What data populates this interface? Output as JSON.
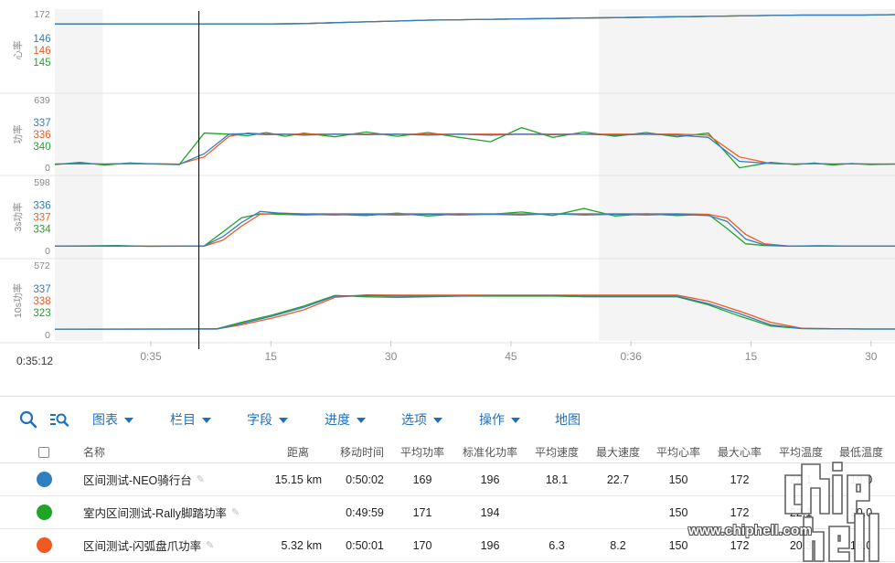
{
  "colors": {
    "series_blue": "#2f7ec1",
    "series_orange": "#f05a22",
    "series_green": "#21a32a",
    "accent": "#1f6fbf",
    "selection_fill": "#ffffff",
    "outside_fill": "#f4f4f4"
  },
  "chart_data": [
    {
      "type": "line",
      "ylabel": "心率",
      "ylim": [
        0,
        172
      ],
      "y_top_label": "172",
      "y_bottom_label": "",
      "legend_values": [
        {
          "series": "区间测试-NEO骑行台",
          "value": "146"
        },
        {
          "series": "区间测试-闪弧盘爪功率",
          "value": "146"
        },
        {
          "series": "室内区间测试-Rally脚踏功率",
          "value": "145"
        }
      ],
      "x": [
        0,
        10,
        20,
        30,
        40,
        50,
        60,
        70,
        80,
        90,
        100,
        110,
        120,
        130,
        140,
        150,
        160,
        170,
        180,
        190,
        200,
        210,
        220,
        230,
        240,
        250,
        260,
        270
      ],
      "series": [
        {
          "name": "区间测试-NEO骑行台",
          "values": [
            150,
            150,
            150,
            150,
            150,
            150,
            150,
            150,
            151,
            153,
            155,
            157,
            159,
            160,
            161,
            162,
            163,
            164,
            165,
            166,
            167,
            168,
            169,
            170,
            171,
            171,
            171,
            172
          ]
        },
        {
          "name": "区间测试-闪弧盘爪功率",
          "values": [
            150,
            150,
            150,
            150,
            150,
            150,
            150,
            150,
            151,
            153,
            155,
            157,
            159,
            160,
            161,
            162,
            163,
            164,
            165,
            166,
            167,
            168,
            169,
            170,
            171,
            171,
            171,
            172
          ]
        },
        {
          "name": "室内区间测试-Rally脚踏功率",
          "values": [
            150,
            150,
            150,
            150,
            150,
            150,
            150,
            150,
            151,
            153,
            155,
            157,
            159,
            160,
            161,
            162,
            163,
            164,
            165,
            166,
            167,
            168,
            169,
            170,
            171,
            171,
            171,
            172
          ]
        }
      ]
    },
    {
      "type": "line",
      "ylabel": "功率",
      "ylim": [
        0,
        639
      ],
      "y_top_label": "639",
      "y_bottom_label": "0",
      "legend_values": [
        {
          "series": "区间测试-NEO骑行台",
          "value": "337"
        },
        {
          "series": "区间测试-闪弧盘爪功率",
          "value": "336"
        },
        {
          "series": "室内区间测试-Rally脚踏功率",
          "value": "340"
        }
      ],
      "x": [
        0,
        8,
        16,
        24,
        32,
        40,
        48,
        56,
        62,
        68,
        74,
        80,
        90,
        100,
        110,
        120,
        130,
        140,
        150,
        160,
        170,
        180,
        190,
        200,
        210,
        220,
        230,
        238,
        244,
        250,
        256,
        262,
        270
      ],
      "series": [
        {
          "name": "区间测试-NEO骑行台",
          "values": [
            55,
            60,
            55,
            60,
            58,
            52,
            150,
            330,
            335,
            325,
            330,
            320,
            330,
            325,
            330,
            320,
            330,
            320,
            330,
            325,
            330,
            320,
            330,
            320,
            300,
            80,
            60,
            55,
            60,
            55,
            58,
            55,
            55
          ]
        },
        {
          "name": "区间测试-闪弧盘爪功率",
          "values": [
            55,
            58,
            55,
            58,
            56,
            55,
            120,
            310,
            340,
            330,
            330,
            330,
            330,
            330,
            330,
            330,
            330,
            330,
            330,
            330,
            330,
            330,
            330,
            330,
            320,
            120,
            60,
            55,
            58,
            55,
            56,
            55,
            55
          ]
        },
        {
          "name": "室内区间测试-Rally脚踏功率",
          "values": [
            50,
            70,
            45,
            65,
            55,
            50,
            340,
            330,
            315,
            345,
            310,
            340,
            305,
            350,
            310,
            345,
            300,
            260,
            390,
            300,
            350,
            310,
            345,
            305,
            340,
            20,
            70,
            50,
            65,
            45,
            60,
            50,
            55
          ]
        }
      ]
    },
    {
      "type": "line",
      "ylabel": "3s功率",
      "ylim": [
        0,
        598
      ],
      "y_top_label": "598",
      "y_bottom_label": "0",
      "legend_values": [
        {
          "series": "区间测试-NEO骑行台",
          "value": "336"
        },
        {
          "series": "区间测试-闪弧盘爪功率",
          "value": "337"
        },
        {
          "series": "室内区间测试-Rally脚踏功率",
          "value": "334"
        }
      ],
      "x": [
        0,
        10,
        20,
        30,
        40,
        48,
        54,
        60,
        66,
        72,
        80,
        90,
        100,
        110,
        120,
        130,
        140,
        150,
        160,
        170,
        180,
        190,
        200,
        210,
        216,
        222,
        228,
        236,
        246,
        256,
        270
      ],
      "series": [
        {
          "name": "区间测试-NEO骑行台",
          "values": [
            60,
            60,
            62,
            58,
            60,
            62,
            140,
            260,
            355,
            340,
            330,
            325,
            330,
            325,
            330,
            325,
            330,
            325,
            335,
            325,
            330,
            325,
            330,
            320,
            270,
            120,
            70,
            60,
            62,
            60,
            60
          ]
        },
        {
          "name": "区间测试-闪弧盘爪功率",
          "values": [
            60,
            60,
            60,
            60,
            60,
            60,
            110,
            230,
            330,
            340,
            335,
            335,
            335,
            335,
            335,
            335,
            335,
            335,
            335,
            335,
            335,
            335,
            335,
            330,
            300,
            160,
            80,
            60,
            60,
            60,
            60
          ]
        },
        {
          "name": "室内区间测试-Rally脚踏功率",
          "values": [
            60,
            62,
            65,
            58,
            60,
            62,
            180,
            300,
            335,
            330,
            325,
            330,
            320,
            340,
            315,
            335,
            330,
            350,
            320,
            380,
            315,
            335,
            320,
            330,
            210,
            80,
            65,
            60,
            63,
            60,
            60
          ]
        }
      ]
    },
    {
      "type": "line",
      "ylabel": "10s功率",
      "ylim": [
        0,
        572
      ],
      "y_top_label": "572",
      "y_bottom_label": "0",
      "legend_values": [
        {
          "series": "区间测试-NEO骑行台",
          "value": "337"
        },
        {
          "series": "区间测试-闪弧盘爪功率",
          "value": "338"
        },
        {
          "series": "室内区间测试-Rally脚踏功率",
          "value": "323"
        }
      ],
      "x": [
        0,
        20,
        40,
        52,
        60,
        70,
        80,
        90,
        100,
        110,
        120,
        130,
        140,
        150,
        160,
        170,
        180,
        190,
        200,
        210,
        220,
        230,
        240,
        250,
        260,
        270
      ],
      "series": [
        {
          "name": "区间测试-NEO骑行台",
          "values": [
            65,
            65,
            66,
            66,
            110,
            170,
            240,
            330,
            335,
            330,
            330,
            330,
            335,
            335,
            335,
            330,
            330,
            330,
            330,
            270,
            190,
            100,
            70,
            68,
            66,
            66
          ]
        },
        {
          "name": "区间测试-闪弧盘爪功率",
          "values": [
            65,
            65,
            66,
            66,
            100,
            155,
            220,
            320,
            340,
            338,
            338,
            338,
            338,
            338,
            338,
            338,
            338,
            338,
            338,
            290,
            210,
            120,
            72,
            68,
            66,
            66
          ]
        },
        {
          "name": "室内区间测试-Rally脚踏功率",
          "values": [
            65,
            66,
            66,
            68,
            120,
            180,
            250,
            335,
            325,
            320,
            325,
            330,
            330,
            330,
            330,
            325,
            325,
            325,
            325,
            260,
            170,
            90,
            70,
            68,
            66,
            66
          ]
        }
      ]
    }
  ],
  "x_axis": {
    "ticks": [
      {
        "label": "0:35",
        "t": 60
      },
      {
        "label": "15",
        "t": 75
      },
      {
        "label": "30",
        "t": 90
      },
      {
        "label": "45",
        "t": 105
      },
      {
        "label": "0:36",
        "t": 120
      },
      {
        "label": "15",
        "t": 135
      },
      {
        "label": "30",
        "t": 150
      }
    ],
    "view_range": [
      48,
      153
    ],
    "selection_range": [
      54,
      116
    ],
    "cursor_t": 66
  },
  "cursor_time": "0:35:12",
  "toolbar": {
    "search_icon": "search-icon",
    "zoom_list_icon": "zoom-list-icon",
    "menus": [
      "图表",
      "栏目",
      "字段",
      "进度",
      "选项",
      "操作"
    ],
    "map_label": "地图"
  },
  "table": {
    "headers": [
      "名称",
      "距离",
      "移动时间",
      "平均功率",
      "标准化功率",
      "平均速度",
      "最大速度",
      "平均心率",
      "最大心率",
      "平均温度",
      "最低温度"
    ],
    "rows": [
      {
        "color": "#2f7ec1",
        "name": "区间测试-NEO骑行台",
        "distance": "15.15 km",
        "moving_time": "0:50:02",
        "avg_power": "169",
        "np": "196",
        "avg_speed": "18.1",
        "max_speed": "22.7",
        "avg_hr": "150",
        "max_hr": "172",
        "avg_temp": "22.1",
        "min_temp": "19.0"
      },
      {
        "color": "#21a32a",
        "name": "室内区间测试-Rally脚踏功率",
        "distance": "",
        "moving_time": "0:49:59",
        "avg_power": "171",
        "np": "194",
        "avg_speed": "",
        "max_speed": "",
        "avg_hr": "150",
        "max_hr": "172",
        "avg_temp": "22.1",
        "min_temp": "20.0"
      },
      {
        "color": "#f05a22",
        "name": "区间测试-闪弧盘爪功率",
        "distance": "5.32 km",
        "moving_time": "0:50:01",
        "avg_power": "170",
        "np": "196",
        "avg_speed": "6.3",
        "max_speed": "8.2",
        "avg_hr": "150",
        "max_hr": "172",
        "avg_temp": "20.3",
        "min_temp": "18.0"
      }
    ]
  },
  "watermark": {
    "logo_text": "chip hell",
    "url": "www.chiphell.com"
  }
}
